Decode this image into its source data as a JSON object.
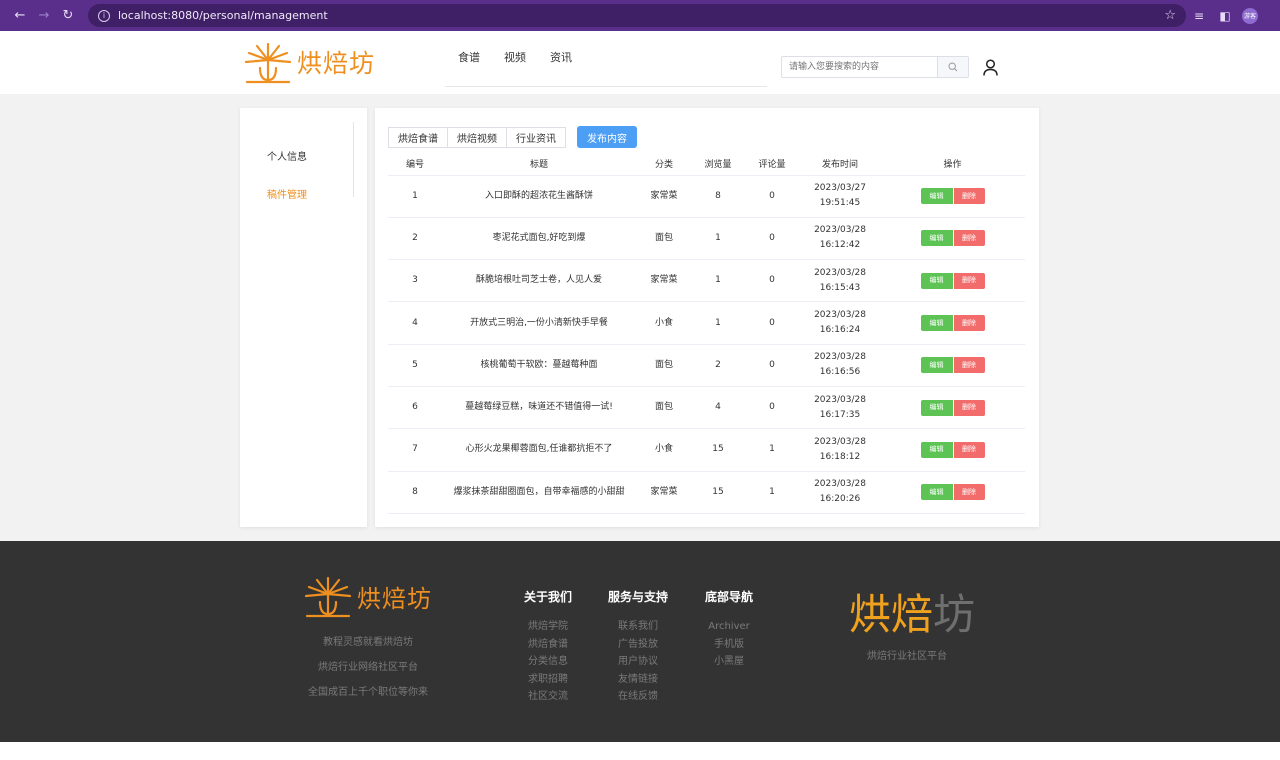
{
  "browser": {
    "url": "localhost:8080/personal/management",
    "profile_label": "游客"
  },
  "header": {
    "logo_text": "烘焙坊",
    "nav": [
      "食谱",
      "视频",
      "资讯"
    ],
    "search_placeholder": "请输入您要搜索的内容"
  },
  "sidebar": {
    "items": [
      {
        "label": "个人信息",
        "active": false
      },
      {
        "label": "稿件管理",
        "active": true
      }
    ]
  },
  "content": {
    "tabs": [
      "烘焙食谱",
      "烘焙视频",
      "行业资讯"
    ],
    "publish_label": "发布内容",
    "columns": [
      "编号",
      "标题",
      "分类",
      "浏览量",
      "评论量",
      "发布时间",
      "操作"
    ],
    "edit_label": "编辑",
    "delete_label": "删除",
    "rows": [
      {
        "id": "1",
        "title": "入口即酥的超浓花生酱酥饼",
        "category": "家常菜",
        "views": "8",
        "comments": "0",
        "date": "2023/03/27",
        "time": "19:51:45"
      },
      {
        "id": "2",
        "title": "枣泥花式面包,好吃到爆",
        "category": "面包",
        "views": "1",
        "comments": "0",
        "date": "2023/03/28",
        "time": "16:12:42"
      },
      {
        "id": "3",
        "title": "酥脆培根吐司芝士卷，人见人爱",
        "category": "家常菜",
        "views": "1",
        "comments": "0",
        "date": "2023/03/28",
        "time": "16:15:43"
      },
      {
        "id": "4",
        "title": "开放式三明治,一份小清新快手早餐",
        "category": "小食",
        "views": "1",
        "comments": "0",
        "date": "2023/03/28",
        "time": "16:16:24"
      },
      {
        "id": "5",
        "title": "核桃葡萄干软欧：蔓越莓种面",
        "category": "面包",
        "views": "2",
        "comments": "0",
        "date": "2023/03/28",
        "time": "16:16:56"
      },
      {
        "id": "6",
        "title": "蔓越莓绿豆糕，味道还不错值得一试!",
        "category": "面包",
        "views": "4",
        "comments": "0",
        "date": "2023/03/28",
        "time": "16:17:35"
      },
      {
        "id": "7",
        "title": "心形火龙果椰蓉面包,任谁都抗拒不了",
        "category": "小食",
        "views": "15",
        "comments": "1",
        "date": "2023/03/28",
        "time": "16:18:12"
      },
      {
        "id": "8",
        "title": "爆浆抹茶甜甜圈面包，自带幸福感的小甜甜",
        "category": "家常菜",
        "views": "15",
        "comments": "1",
        "date": "2023/03/28",
        "time": "16:20:26"
      }
    ]
  },
  "footer": {
    "logo_text": "烘焙坊",
    "taglines": [
      "教程灵感就看烘焙坊",
      "烘焙行业网络社区平台",
      "全国成百上千个职位等你来"
    ],
    "columns": [
      {
        "title": "关于我们",
        "links": [
          "烘焙学院",
          "烘焙食谱",
          "分类信息",
          "求职招聘",
          "社区交流"
        ]
      },
      {
        "title": "服务与支持",
        "links": [
          "联系我们",
          "广告投放",
          "用户协议",
          "友情链接",
          "在线反馈"
        ]
      },
      {
        "title": "底部导航",
        "links": [
          "Archiver",
          "手机版",
          "小黑屋"
        ]
      }
    ],
    "brand_part1": "烘焙",
    "brand_part2": "坊",
    "brand_sub": "烘焙行业社区平台"
  },
  "colors": {
    "brand_orange": "#ee8f1f",
    "chrome_purple": "#5a2f8c",
    "primary_blue": "#4d9ef5",
    "edit_green": "#5cc354",
    "delete_red": "#f26c6c",
    "footer_bg": "#333333"
  }
}
